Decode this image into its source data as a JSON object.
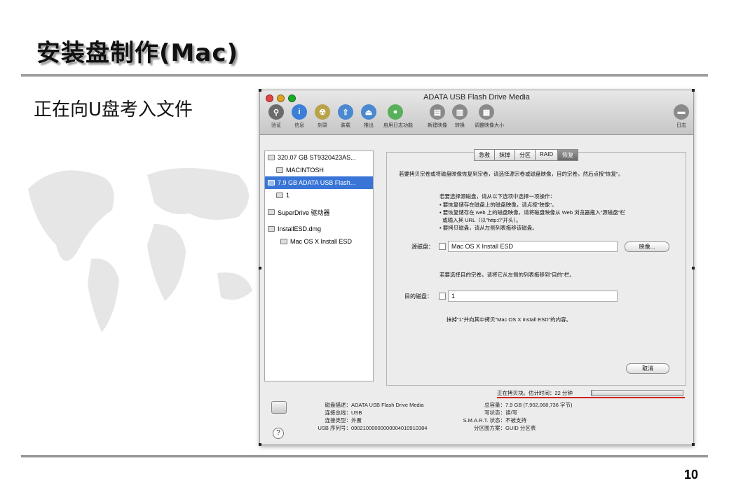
{
  "slide": {
    "title": "安装盘制作(Mac)",
    "subtitle": "正在向U盘考入文件",
    "page_number": "10"
  },
  "window": {
    "title": "ADATA USB Flash Drive Media",
    "traffic_colors": [
      "#e0443e",
      "#dea123",
      "#1aab29"
    ],
    "toolbar": [
      {
        "label": "验证",
        "icon": "microscope-icon",
        "glyph": "⚲",
        "color": "#6b6b6b"
      },
      {
        "label": "信息",
        "icon": "info-icon",
        "glyph": "i",
        "color": "#3b7fd8"
      },
      {
        "label": "刻录",
        "icon": "burn-icon",
        "glyph": "☢",
        "color": "#b9a24a"
      },
      {
        "label": "装载",
        "icon": "mount-icon",
        "glyph": "⇧",
        "color": "#4a88d0"
      },
      {
        "label": "推出",
        "icon": "eject-icon",
        "glyph": "⏏",
        "color": "#4a88d0"
      },
      {
        "label": "启用日志功能",
        "icon": "journal-icon",
        "glyph": "●",
        "color": "#58b05a"
      },
      {
        "label": "新建映像",
        "icon": "new-image-icon",
        "glyph": "▤",
        "color": "#8a8a8a"
      },
      {
        "label": "转换",
        "icon": "convert-icon",
        "glyph": "▥",
        "color": "#8a8a8a"
      },
      {
        "label": "调整映像大小",
        "icon": "resize-image-icon",
        "glyph": "▦",
        "color": "#8a8a8a"
      },
      {
        "label": "日志",
        "icon": "log-icon",
        "glyph": "▬",
        "color": "#8a8a8a"
      }
    ],
    "sidebar": [
      {
        "label": "320.07 GB ST9320423AS...",
        "level": 0,
        "selected": false
      },
      {
        "label": "MACINTOSH",
        "level": 1,
        "selected": false
      },
      {
        "label": "7.9 GB ADATA USB Flash...",
        "level": 0,
        "selected": true
      },
      {
        "label": "1",
        "level": 1,
        "selected": false
      },
      {
        "label": "SuperDrive 驱动器",
        "level": 0,
        "selected": false
      },
      {
        "label": "InstallESD.dmg",
        "level": 0,
        "selected": false
      },
      {
        "label": "Mac OS X Install ESD",
        "level": 2,
        "selected": false
      }
    ],
    "tabs": [
      "急救",
      "抹掉",
      "分区",
      "RAID",
      "恢复"
    ],
    "active_tab": "恢复",
    "restore": {
      "intro": "若要拷贝宗卷或将磁盘映像恢复到宗卷，请选择源宗卷或磁盘映像，目的宗卷，然后点按\"恢复\"。",
      "source_help_title": "若要选择源磁盘，请从以下选项中选择一项操作：",
      "source_help": [
        "• 要恢复储存在磁盘上的磁盘映像，请点按\"映像\"。",
        "• 要恢复储存在 web 上的磁盘映像，请将磁盘映像从 Web 浏览器拖入\"源磁盘\"栏",
        "  或输入其 URL（以\"http://\"开头）。",
        "• 要拷贝磁盘，请从左侧列表拖移该磁盘。"
      ],
      "source_label": "源磁盘：",
      "source_value": "Mac OS X Install ESD",
      "image_button": "映像...",
      "dest_help": "若要选择目的宗卷，请将它从左侧的列表拖移到\"目的\"栏。",
      "dest_label": "目的磁盘：",
      "dest_value": "1",
      "summary": "抹掉\"1\"并向其中拷贝\"Mac OS X Install ESD\"的内容。",
      "cancel_button": "取消"
    },
    "status": {
      "text": "正在拷贝块。估计时间：22 分钟",
      "progress": 0.01
    },
    "info_left": [
      {
        "key": "磁盘描述：",
        "value": "ADATA USB Flash Drive Media"
      },
      {
        "key": "连接总线：",
        "value": "USB"
      },
      {
        "key": "连接类型：",
        "value": "外置"
      },
      {
        "key": "USB 序列号：",
        "value": "09021000000000004010910384"
      }
    ],
    "info_right": [
      {
        "key": "总容量：",
        "value": "7.9 GB (7,902,068,736 字节)"
      },
      {
        "key": "写状态：",
        "value": "读/写"
      },
      {
        "key": "S.M.A.R.T. 状态：",
        "value": "不被支持"
      },
      {
        "key": "分区图方案：",
        "value": "GUID 分区表"
      }
    ],
    "help_glyph": "?"
  },
  "colors": {
    "selection": "#3875d7",
    "annotation_red": "#d2231c"
  }
}
